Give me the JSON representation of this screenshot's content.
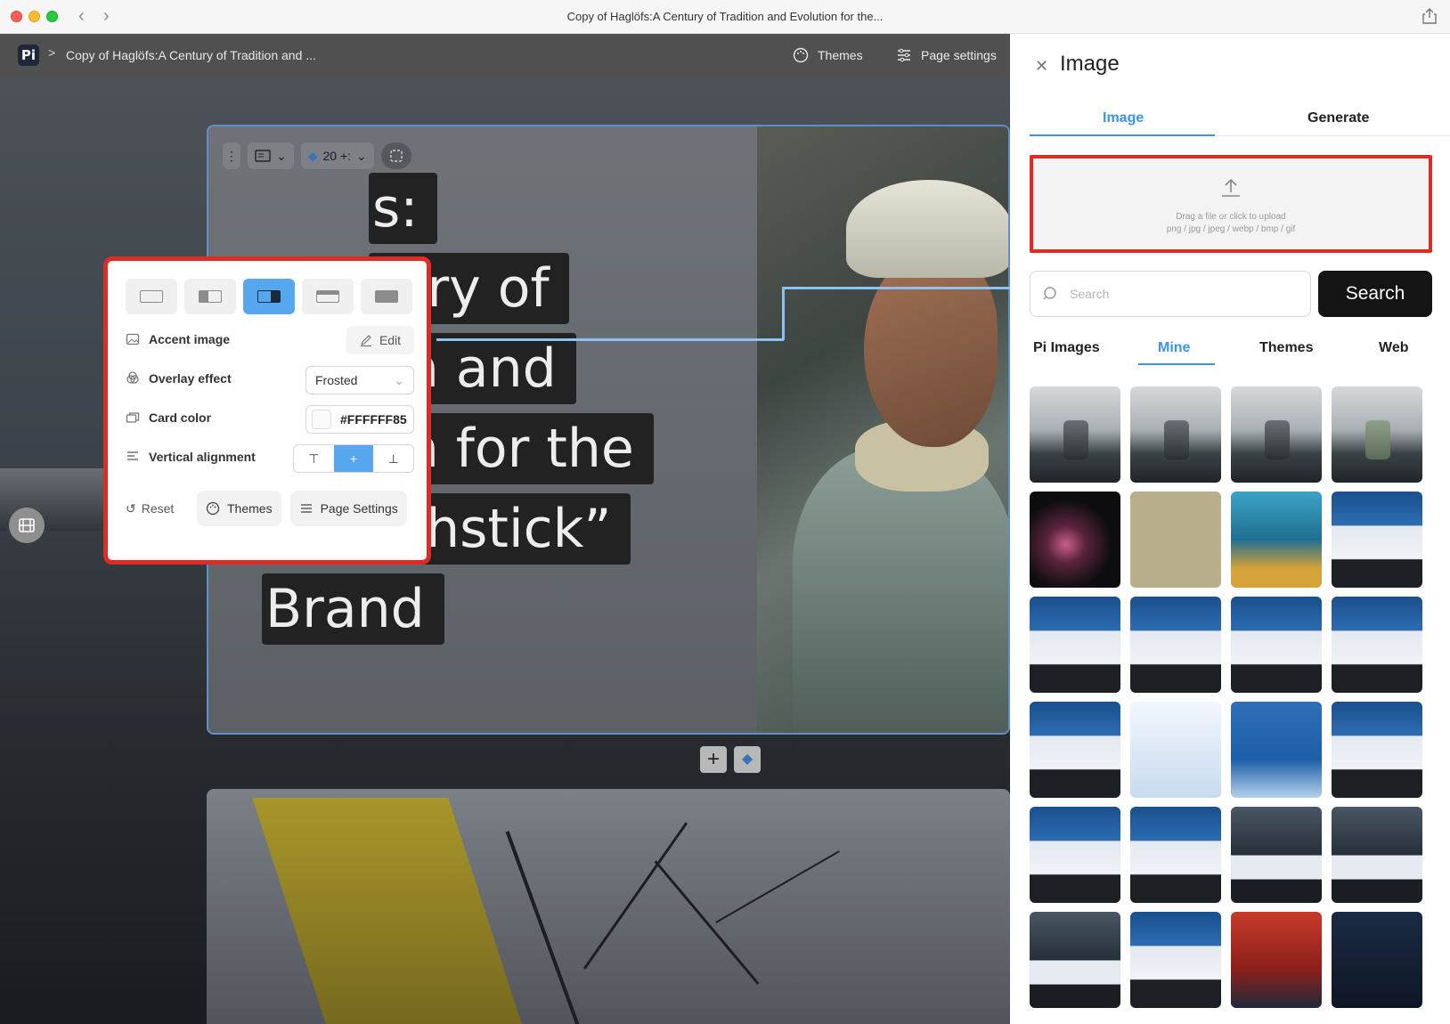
{
  "window": {
    "title": "Copy of Haglöfs:A Century of Tradition and Evolution for the..."
  },
  "editor": {
    "breadcrumb_title": "Copy of Haglöfs:A Century of Tradition and ...",
    "themes_label": "Themes",
    "page_settings_label": "Page settings"
  },
  "slide": {
    "toolbar": {
      "spacing_value": "20 +:"
    },
    "title_lines": [
      "s:",
      "tury of",
      "on and",
      "on for the",
      "“Matchstick”",
      "Brand"
    ]
  },
  "popover": {
    "accent_image_label": "Accent image",
    "edit_label": "Edit",
    "overlay_effect_label": "Overlay effect",
    "overlay_effect_value": "Frosted",
    "card_color_label": "Card color",
    "card_color_value": "#FFFFFF85",
    "vertical_alignment_label": "Vertical alignment",
    "reset_label": "Reset",
    "themes_label": "Themes",
    "page_settings_label": "Page Settings",
    "selected_layout": "card-right-accent",
    "selected_alignment": "middle"
  },
  "panel": {
    "title": "Image",
    "tabs": [
      {
        "label": "Image",
        "active": true
      },
      {
        "label": "Generate",
        "active": false
      }
    ],
    "upload": {
      "line1": "Drag a file or click to upload",
      "line2": "png / jpg / jpeg / webp / bmp / gif"
    },
    "search": {
      "placeholder": "Search",
      "button_label": "Search"
    },
    "source_tabs": [
      {
        "label": "Pi Images",
        "active": false
      },
      {
        "label": "Mine",
        "active": true
      },
      {
        "label": "Themes",
        "active": false
      },
      {
        "label": "Web",
        "active": false
      }
    ],
    "thumbnails": [
      "lake-device",
      "lake-device",
      "lake-device",
      "lake-bag",
      "pink-light",
      "sand",
      "smoke-van",
      "laptop-slide",
      "laptop-slide",
      "laptop-slide",
      "laptop-slide",
      "laptop-slide",
      "laptop-slide",
      "light-blue",
      "blue-gradient",
      "laptop-slide",
      "laptop-slide",
      "laptop-slide",
      "office-laptop",
      "office-laptop",
      "office-laptop",
      "laptop-slide",
      "red-football",
      "navy-football"
    ]
  },
  "colors": {
    "accent": "#57a7ef",
    "highlight": "#e02a25",
    "tab_active": "#3b94e8"
  }
}
